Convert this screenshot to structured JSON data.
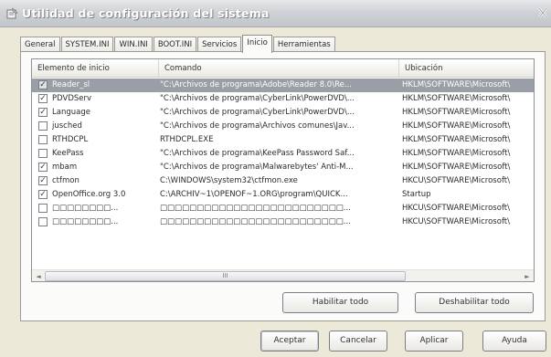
{
  "window": {
    "title": "Utilidad de configuración del sistema",
    "close_glyph": "✕",
    "icon": "msconfig-icon"
  },
  "tabs": [
    {
      "label": "General",
      "active": false
    },
    {
      "label": "SYSTEM.INI",
      "active": false
    },
    {
      "label": "WIN.INI",
      "active": false
    },
    {
      "label": "BOOT.INI",
      "active": false
    },
    {
      "label": "Servicios",
      "active": false
    },
    {
      "label": "Inicio",
      "active": true
    },
    {
      "label": "Herramientas",
      "active": false
    }
  ],
  "list": {
    "columns": [
      "Elemento de inicio",
      "Comando",
      "Ubicación"
    ],
    "check_glyph": "✓",
    "rows": [
      {
        "checked": true,
        "selected": true,
        "name": "Reader_sl",
        "command": "\"C:\\Archivos de programa\\Adobe\\Reader 8.0\\Re...",
        "location": "HKLM\\SOFTWARE\\Microsoft\\"
      },
      {
        "checked": true,
        "selected": false,
        "name": "PDVDServ",
        "command": "\"C:\\Archivos de programa\\CyberLink\\PowerDVD\\...",
        "location": "HKLM\\SOFTWARE\\Microsoft\\"
      },
      {
        "checked": true,
        "selected": false,
        "name": "Language",
        "command": "\"C:\\Archivos de programa\\CyberLink\\PowerDVD\\...",
        "location": "HKLM\\SOFTWARE\\Microsoft\\"
      },
      {
        "checked": false,
        "selected": false,
        "name": "jusched",
        "command": "\"C:\\Archivos de programa\\Archivos comunes\\Jav...",
        "location": "HKLM\\SOFTWARE\\Microsoft\\"
      },
      {
        "checked": false,
        "selected": false,
        "name": "RTHDCPL",
        "command": "RTHDCPL.EXE",
        "location": "HKLM\\SOFTWARE\\Microsoft\\"
      },
      {
        "checked": false,
        "selected": false,
        "name": "KeePass",
        "command": "\"C:\\Archivos de programa\\KeePass Password Saf...",
        "location": "HKLM\\SOFTWARE\\Microsoft\\"
      },
      {
        "checked": true,
        "selected": false,
        "name": "mbam",
        "command": "\"C:\\Archivos de programa\\Malwarebytes' Anti-M...",
        "location": "HKLM\\SOFTWARE\\Microsoft\\"
      },
      {
        "checked": true,
        "selected": false,
        "name": "ctfmon",
        "command": "C:\\WINDOWS\\system32\\ctfmon.exe",
        "location": "HKCU\\SOFTWARE\\Microsoft\\"
      },
      {
        "checked": true,
        "selected": false,
        "name": "OpenOffice.org 3.0",
        "command": "C:\\ARCHIV~1\\OPENOF~1.ORG\\program\\QUICK...",
        "location": "Startup"
      },
      {
        "checked": false,
        "selected": false,
        "name": "□□□□□□□□...",
        "command": "□□□□□□□□□□□□□□□□□□□□□□□□□...",
        "location": "HKCU\\SOFTWARE\\Microsoft\\"
      },
      {
        "checked": false,
        "selected": false,
        "name": "□□□□□□□□...",
        "command": "□□□□□□□□□□□□□□□□□□□□□□□□□...",
        "location": "HKCU\\SOFTWARE\\Microsoft\\"
      }
    ],
    "scroll_left_glyph": "◄",
    "scroll_right_glyph": "►",
    "scroll_grip": "III"
  },
  "buttons": {
    "enable_all": "Habilitar todo",
    "disable_all": "Deshabilitar todo",
    "ok": "Aceptar",
    "cancel": "Cancelar",
    "apply": "Aplicar",
    "help": "Ayuda"
  }
}
